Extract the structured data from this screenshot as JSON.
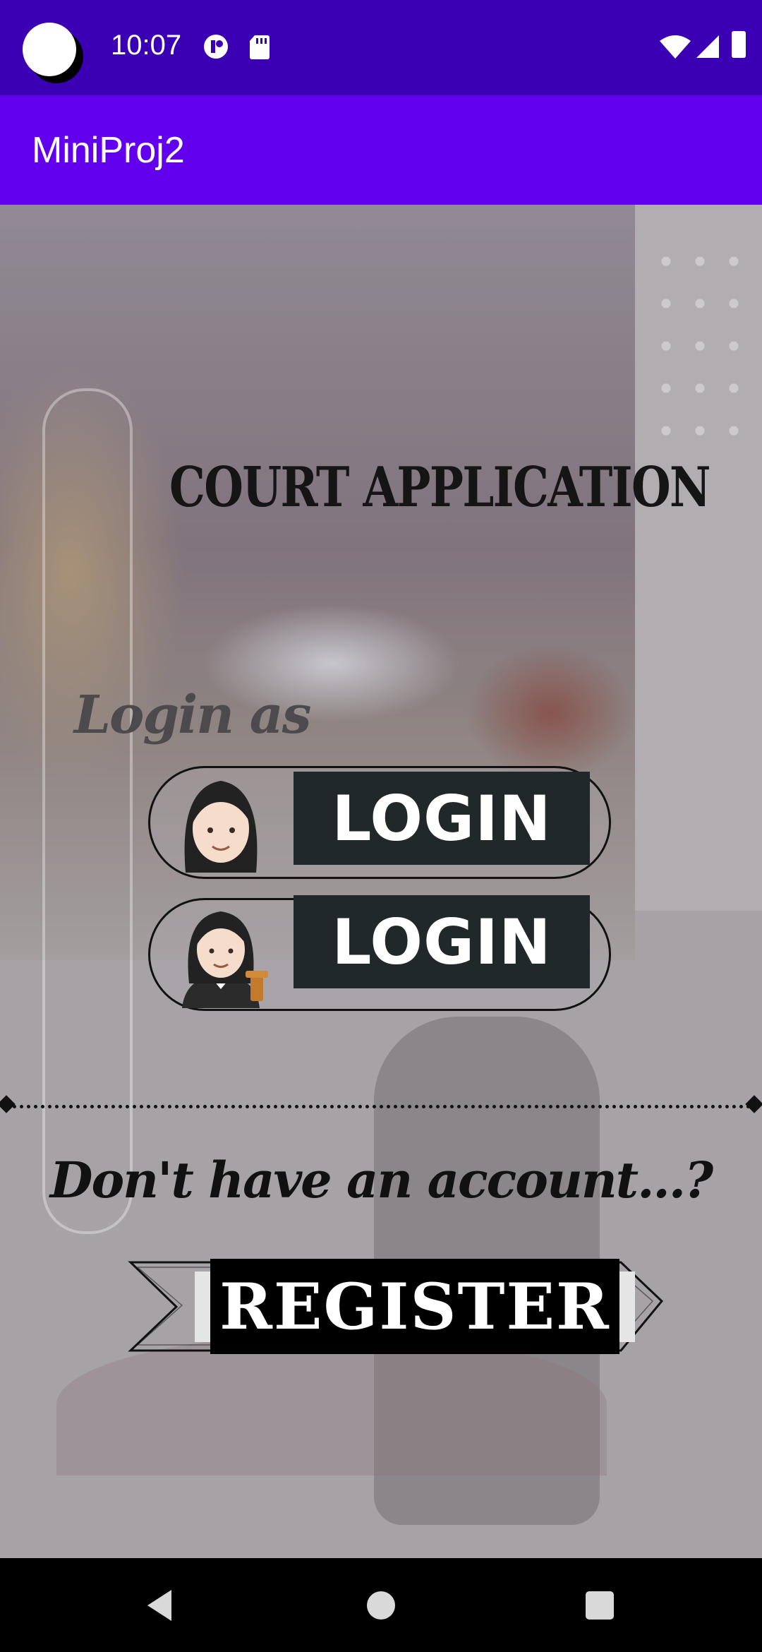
{
  "status_bar": {
    "time": "10:07",
    "icons": [
      "camera-cutout",
      "notification-icon",
      "sd-card-icon",
      "wifi-icon",
      "signal-icon",
      "battery-icon"
    ]
  },
  "app_bar": {
    "title": "MiniProj2"
  },
  "main": {
    "heading": "COURT APPLICATION",
    "login_as": "Login as",
    "logins": [
      {
        "avatar": "woman-icon",
        "label": "LOGIN"
      },
      {
        "avatar": "woman-judge-icon",
        "label": "LOGIN"
      }
    ],
    "no_account": "Don't have an account...?",
    "register_label": "REGISTER"
  },
  "nav_bar": {
    "icons": [
      "back-icon",
      "home-icon",
      "recents-icon"
    ]
  },
  "colors": {
    "status_bar": "#3b00b3",
    "app_bar": "#6200ee",
    "button_dark": "#212829"
  }
}
